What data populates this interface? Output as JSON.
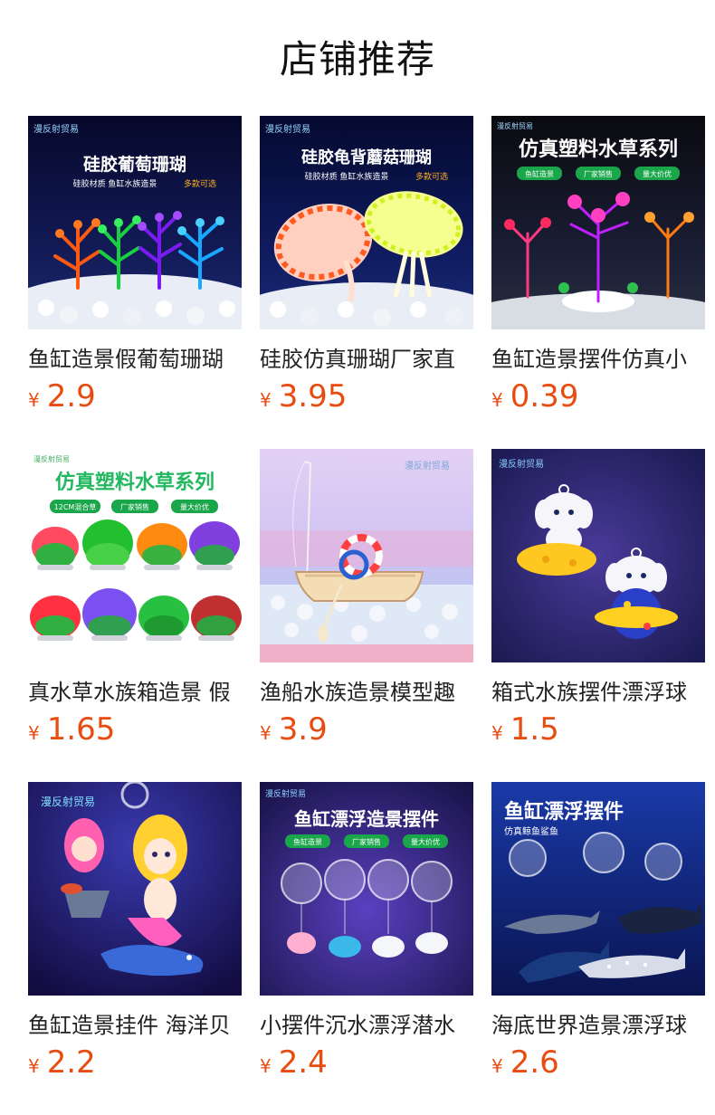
{
  "header": {
    "title": "店铺推荐"
  },
  "currency_symbol": "¥",
  "colors": {
    "price": "#e84c10",
    "title_text": "#111111",
    "name_text": "#222222"
  },
  "products": [
    {
      "name": "鱼缸造景假葡萄珊瑚",
      "price": "2.9",
      "image": {
        "icon": "aquarium-grape-coral-image",
        "brand": "漫反射贸易",
        "headline": "硅胶葡萄珊瑚",
        "subline": "硅胶材质  鱼缸水族造景",
        "highlight": "多款可选"
      }
    },
    {
      "name": "硅胶仿真珊瑚厂家直",
      "price": "3.95",
      "image": {
        "icon": "aquarium-mushroom-coral-image",
        "brand": "漫反射贸易",
        "headline": "硅胶龟背蘑菇珊瑚",
        "subline": "硅胶材质  鱼缸水族造景",
        "highlight": "多款可选"
      }
    },
    {
      "name": "鱼缸造景摆件仿真小",
      "price": "0.39",
      "image": {
        "icon": "aquarium-plastic-plant-image",
        "brand": "漫反射贸易",
        "headline": "仿真塑料水草系列",
        "tags": [
          "鱼缸造景",
          "厂家销售",
          "量大价优"
        ]
      }
    },
    {
      "name": "真水草水族箱造景 假",
      "price": "1.65",
      "image": {
        "icon": "aquarium-water-plants-image",
        "brand": "漫反射贸易",
        "headline": "仿真塑料水草系列",
        "tags": [
          "12CM混合草",
          "厂家销售",
          "量大价优"
        ]
      }
    },
    {
      "name": "渔船水族造景模型趣",
      "price": "3.9",
      "image": {
        "icon": "aquarium-boat-ornament-image",
        "brand": "漫反射贸易"
      }
    },
    {
      "name": "箱式水族摆件漂浮球",
      "price": "1.5",
      "image": {
        "icon": "aquarium-floating-cartoon-image",
        "brand": "漫反射贸易"
      }
    },
    {
      "name": "鱼缸造景挂件 海洋贝",
      "price": "2.2",
      "image": {
        "icon": "aquarium-mermaid-pendant-image",
        "brand": "漫反射贸易"
      }
    },
    {
      "name": "小摆件沉水漂浮潜水",
      "price": "2.4",
      "image": {
        "icon": "aquarium-floating-whale-image",
        "brand": "漫反射贸易",
        "headline": "鱼缸漂浮造景摆件",
        "tags": [
          "鱼缸造景",
          "厂家销售",
          "量大价优"
        ]
      }
    },
    {
      "name": "海底世界造景漂浮球",
      "price": "2.6",
      "image": {
        "icon": "aquarium-floating-shark-image",
        "headline": "鱼缸漂浮摆件",
        "subline": "仿真鲸鱼鲨鱼"
      }
    }
  ]
}
